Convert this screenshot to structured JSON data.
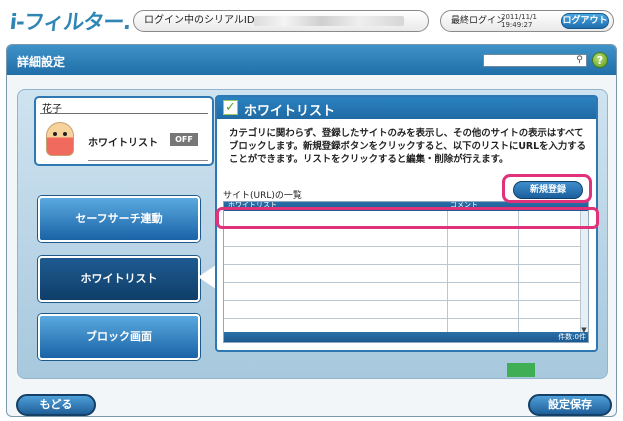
{
  "header": {
    "logo": "i-フィルター.",
    "serial_label": "ログイン中のシリアルID:",
    "last_login_label": "最終ログイン",
    "last_login_date": "2011/11/1",
    "last_login_time": "19:49:27",
    "logout_label": "ログアウト"
  },
  "page": {
    "title": "詳細設定",
    "help_icon": "?"
  },
  "user": {
    "name": "花子",
    "feature_label": "ホワイトリスト",
    "status_badge": "OFF"
  },
  "nav": {
    "items": [
      {
        "label": "セーフサーチ連動"
      },
      {
        "label": "ホワイトリスト"
      },
      {
        "label": "ブロック画面"
      }
    ]
  },
  "content": {
    "title": "ホワイトリスト",
    "description": "カテゴリに関わらず、登録したサイトのみを表示し、その他のサイトの表示はすべてブロックします。新規登録ボタンをクリックすると、以下のリストにURLを入力することができます。リストをクリックすると編集・削除が行えます。",
    "list_label": "サイト(URL)の一覧",
    "new_button": "新規登録",
    "table": {
      "columns": [
        "ホワイトリスト",
        "コメント"
      ],
      "rows": []
    },
    "count_label": "件数:0件"
  },
  "footer": {
    "back_label": "もどる",
    "save_label": "設定保存"
  },
  "colors": {
    "primary_blue": "#1f6aa4",
    "highlight_pink": "#e0317a",
    "accent_green": "#5aa423"
  }
}
